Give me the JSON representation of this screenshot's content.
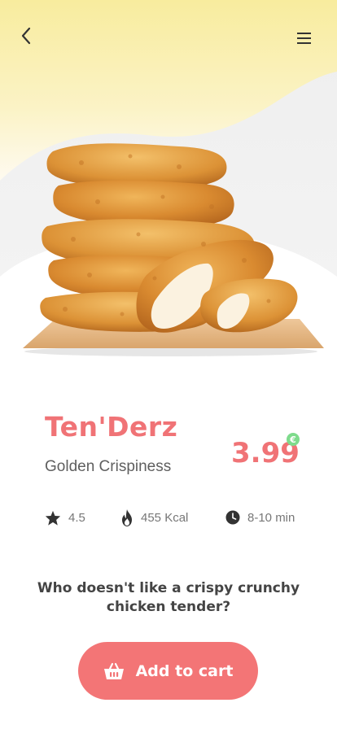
{
  "header": {
    "back_icon": "chevron-left-icon",
    "menu_icon": "hamburger-menu-icon"
  },
  "product": {
    "name": "Ten'Derz",
    "subtitle": "Golden Crispiness",
    "price": "3.99",
    "currency": "€",
    "image": "crispy-chicken-tenders-photo"
  },
  "stats": {
    "rating": "4.5",
    "calories": "455 Kcal",
    "time": "8-10 min",
    "rating_icon": "star-icon",
    "calories_icon": "flame-icon",
    "time_icon": "clock-icon"
  },
  "tagline": "Who doesn't like a crispy crunchy chicken tender?",
  "cta": {
    "label": "Add to cart",
    "icon": "basket-icon"
  },
  "colors": {
    "accent": "#f37576",
    "title": "#f07376",
    "currency_badge": "#7edb8c",
    "hero_yellow": "#f7ecaa"
  }
}
